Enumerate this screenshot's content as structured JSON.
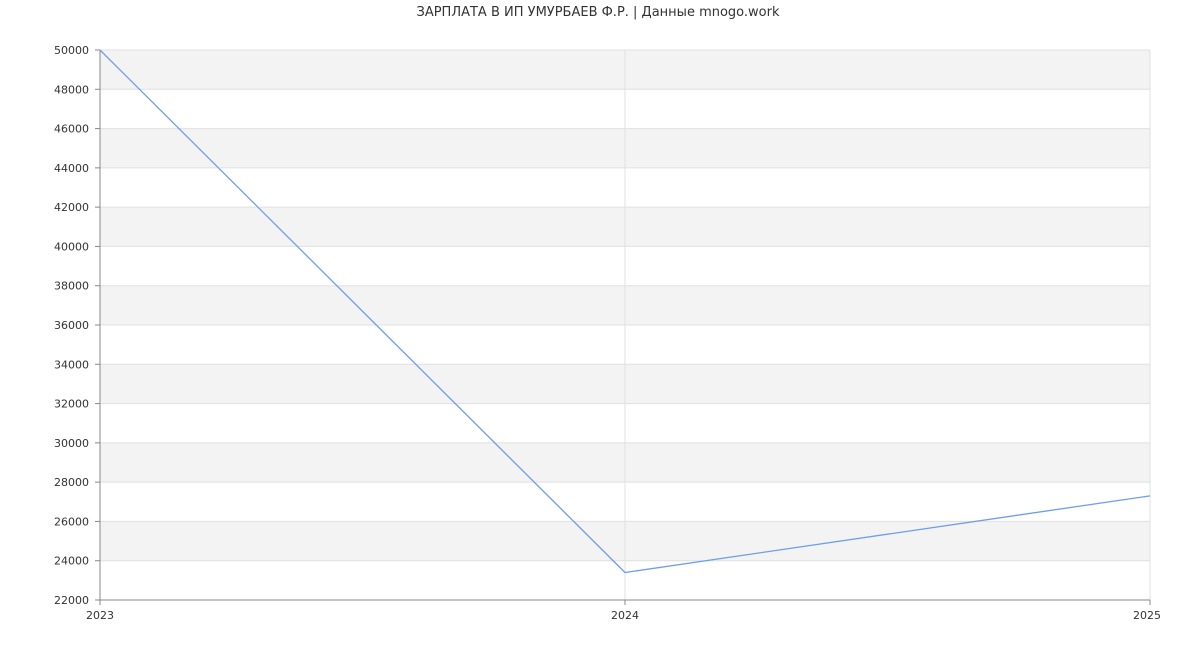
{
  "chart_data": {
    "type": "line",
    "title": "ЗАРПЛАТА В ИП УМУРБАЕВ Ф.Р. | Данные mnogo.work",
    "xlabel": "",
    "ylabel": "",
    "x": [
      "2023",
      "2024",
      "2025"
    ],
    "series": [
      {
        "values": [
          50000,
          23400,
          27300
        ]
      }
    ],
    "ylim": [
      22000,
      50000
    ],
    "yticks": [
      22000,
      24000,
      26000,
      28000,
      30000,
      32000,
      34000,
      36000,
      38000,
      40000,
      42000,
      44000,
      46000,
      48000,
      50000
    ],
    "grid": true,
    "legend": "none",
    "colors": {
      "line": "#6d9eeb",
      "band": "#f3f3f3",
      "grid": "#e0e0e0",
      "axis": "#888888"
    }
  }
}
